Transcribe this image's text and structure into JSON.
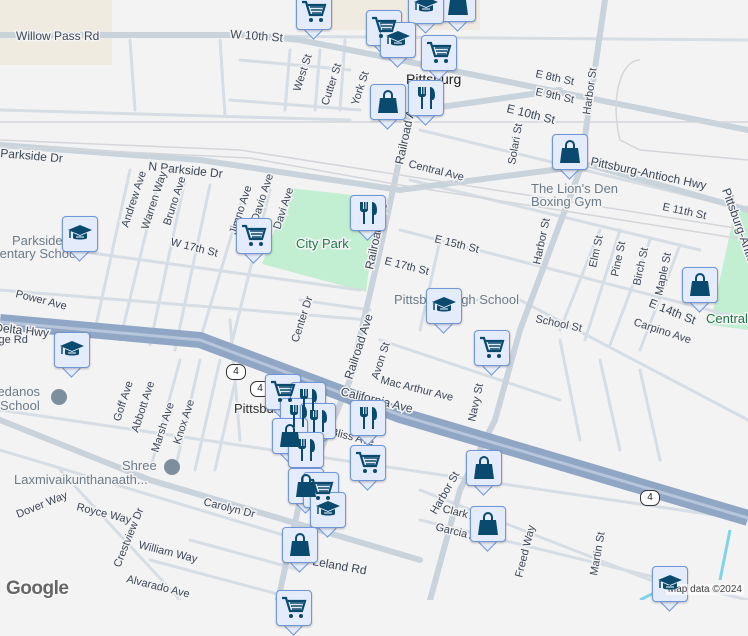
{
  "map": {
    "place": "Pittsburg",
    "streets": {
      "willow_pass": "Willow Pass Rd",
      "w10th": "W 10th St",
      "west": "West St",
      "cutter": "Cutter St",
      "york": "York St",
      "parkside": "Parkside Dr",
      "n_parkside": "N Parkside Dr",
      "andrew": "Andrew Ave",
      "warren": "Warren Way",
      "bruno": "Bruno Ave",
      "jimno": "Jimno Ave",
      "davio": "Davio Ave",
      "davi": "Davi Ave",
      "w17th": "W 17th St",
      "railroad": "Railroad Ave",
      "e8th": "E 8th St",
      "e9th": "E 9th St",
      "e10th": "E 10th St",
      "harbor": "Harbor St",
      "solari": "Solari St",
      "central": "Central Ave",
      "pah": "Pittsburg-Antioch Hwy",
      "e11th": "E 11th St",
      "e15th": "E 15th St",
      "e17th": "E 17th St",
      "elm": "Elm St",
      "pine": "Pine St",
      "birch": "Birch St",
      "maple": "Maple St",
      "e14th": "E 14th St",
      "school": "School St",
      "carpino": "Carpino Ave",
      "power": "Power Ave",
      "cdh": "California Delta Hwy",
      "ridge": "Ridge Rd",
      "center": "Center Dr",
      "avon": "Avon St",
      "macarthur": "Mac Arthur Ave",
      "california": "California Ave",
      "navy": "Navy St",
      "goff": "Goff Ave",
      "abbott": "Abbott Ave",
      "marsh": "Marsh Ave",
      "knox": "Knox Ave",
      "dover": "Dover Way",
      "royce": "Royce Way",
      "crestview": "Crestview Dr",
      "william": "William Way",
      "alvarado": "Alvarado Ave",
      "carolyn": "Carolyn Dr",
      "leland": "Leland Rd",
      "clark": "Clark Ave",
      "garcia": "Garcia Ave",
      "freed": "Freed Way",
      "martin": "Martin St",
      "bliss": "Bliss Ave"
    },
    "pois": {
      "city_park": "City Park",
      "lions_den": "The Lion's Den",
      "lions_den2": "Boxing Gym",
      "parkside_school1": "Parkside",
      "parkside_school2": "Elementary School",
      "high_school": "Pittsburg High School",
      "medanos1": "Los Medanos",
      "medanos2": "School",
      "shree1": "Shree",
      "shree2": "Laxmivaikunthanaath...",
      "central_park": "Central Park",
      "pittsburg_bart": "Pittsburg"
    },
    "route_shield": "4",
    "logo": "Google",
    "attribution": "Map data ©2024",
    "colors": {
      "marker_icon": "#0b4a6f",
      "marker_bg": "#e4ecfb",
      "park": "#c2efd2",
      "highway": "#8fa6c5"
    }
  }
}
